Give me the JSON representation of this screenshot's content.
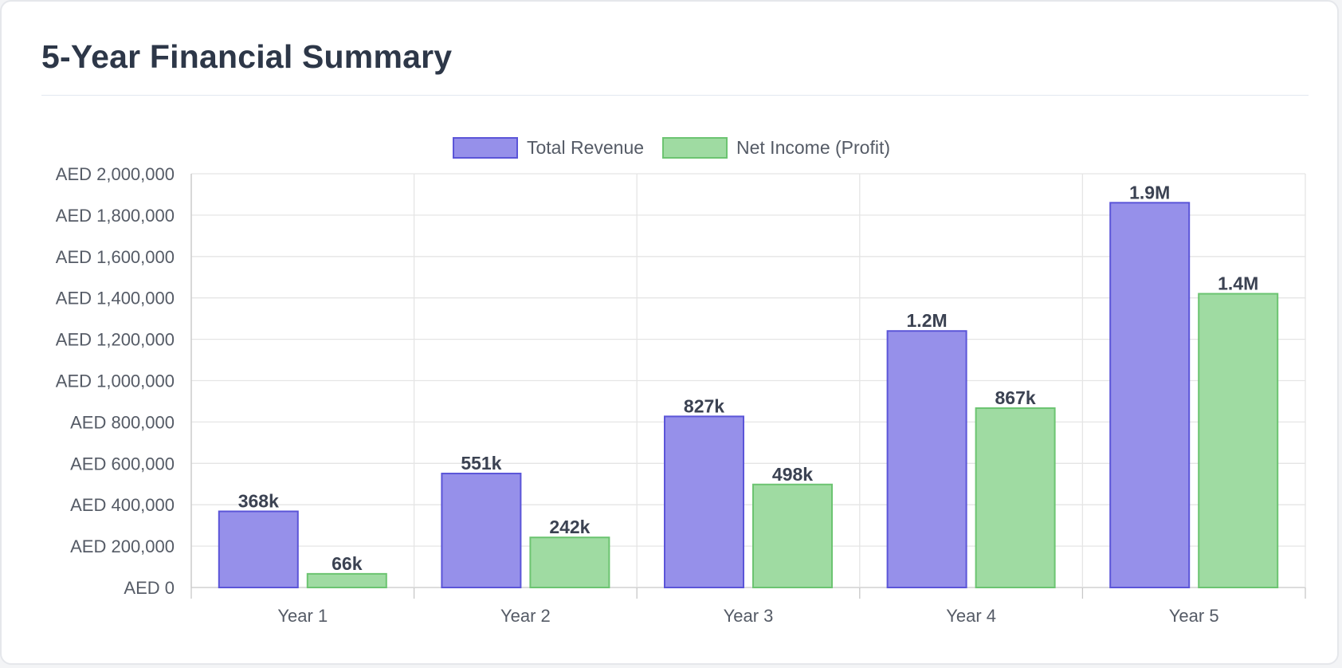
{
  "title": "5-Year Financial Summary",
  "colors": {
    "revenue_fill": "#9690ea",
    "revenue_border": "#5b55d8",
    "income_fill": "#9fdba2",
    "income_border": "#6cc471",
    "grid": "#e5e5e5",
    "axis": "#c8c8c8"
  },
  "chart_data": {
    "type": "bar",
    "categories": [
      "Year 1",
      "Year 2",
      "Year 3",
      "Year 4",
      "Year 5"
    ],
    "series": [
      {
        "name": "Total Revenue",
        "values": [
          368000,
          551000,
          827000,
          1240000,
          1860000
        ],
        "labels": [
          "368k",
          "551k",
          "827k",
          "1.2M",
          "1.9M"
        ]
      },
      {
        "name": "Net Income (Profit)",
        "values": [
          66000,
          242000,
          498000,
          867000,
          1420000
        ],
        "labels": [
          "66k",
          "242k",
          "498k",
          "867k",
          "1.4M"
        ]
      }
    ],
    "ylim": [
      0,
      2000000
    ],
    "yticks": [
      0,
      200000,
      400000,
      600000,
      800000,
      1000000,
      1200000,
      1400000,
      1600000,
      1800000,
      2000000
    ],
    "ytick_labels": [
      "AED 0",
      "AED 200,000",
      "AED 400,000",
      "AED 600,000",
      "AED 800,000",
      "AED 1,000,000",
      "AED 1,200,000",
      "AED 1,400,000",
      "AED 1,600,000",
      "AED 1,800,000",
      "AED 2,000,000"
    ],
    "legend_position": "top-center",
    "grid": true
  }
}
